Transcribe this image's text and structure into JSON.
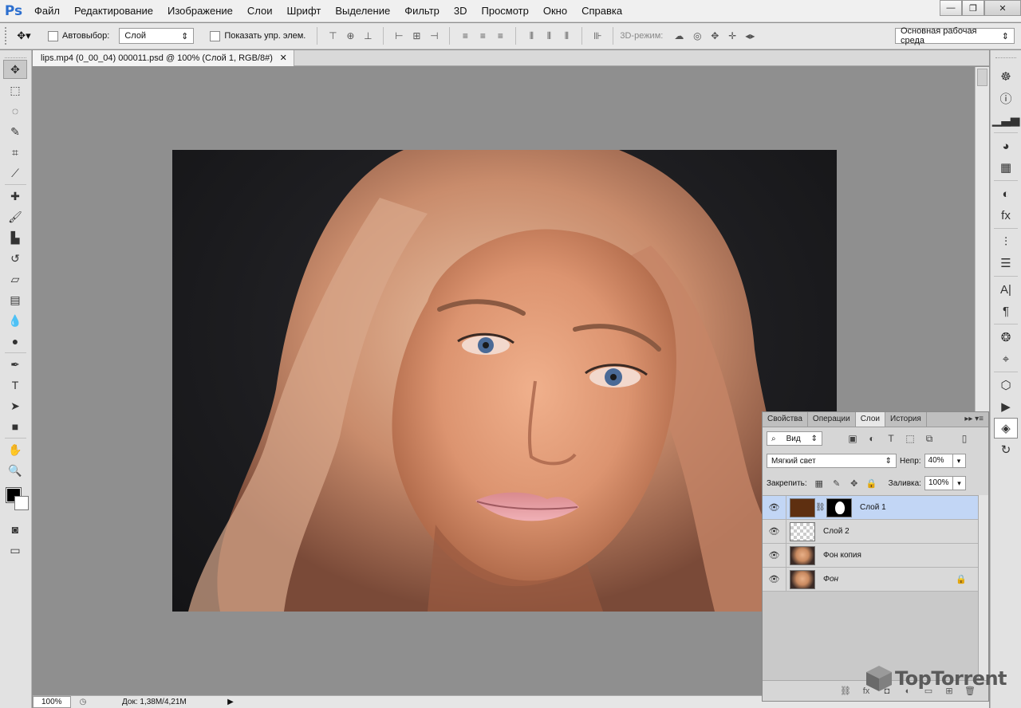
{
  "app": {
    "logo": "Ps"
  },
  "menu": [
    "Файл",
    "Редактирование",
    "Изображение",
    "Слои",
    "Шрифт",
    "Выделение",
    "Фильтр",
    "3D",
    "Просмотр",
    "Окно",
    "Справка"
  ],
  "window_controls": {
    "minimize": "—",
    "restore": "❐",
    "close": "✕"
  },
  "options": {
    "auto_select_label": "Автовыбор:",
    "auto_select_value": "Слой",
    "show_controls_label": "Показать упр. элем.",
    "mode_3d_label": "3D-режим:",
    "workspace_value": "Основная рабочая среда"
  },
  "document": {
    "tab_title": "lips.mp4 (0_00_04) 000011.psd @ 100% (Слой 1, RGB/8#)",
    "tab_close": "✕"
  },
  "status": {
    "zoom": "100%",
    "doc_info": "Док: 1,38М/4,21М",
    "arrow": "▶"
  },
  "layers_panel": {
    "tabs": [
      "Свойства",
      "Операции",
      "Слои",
      "История"
    ],
    "active_tab": "Слои",
    "tab_controls": "▸▸  ▾≡",
    "filter_value": "Вид",
    "blend_mode": "Мягкий свет",
    "opacity_label": "Непр:",
    "opacity_value": "40%",
    "lock_label": "Закрепить:",
    "fill_label": "Заливка:",
    "fill_value": "100%",
    "layers": [
      {
        "name": "Слой 1",
        "selected": true,
        "thumb": "brown",
        "mask": true,
        "italic": false,
        "locked": false
      },
      {
        "name": "Слой 2",
        "selected": false,
        "thumb": "trans",
        "mask": false,
        "italic": false,
        "locked": false
      },
      {
        "name": "Фон копия",
        "selected": false,
        "thumb": "photo",
        "mask": false,
        "italic": false,
        "locked": false
      },
      {
        "name": "Фон",
        "selected": false,
        "thumb": "photo",
        "mask": false,
        "italic": true,
        "locked": true
      }
    ]
  },
  "watermark": {
    "text": "TopTorrent"
  },
  "colors": {
    "foreground": "#000000",
    "background": "#ffffff",
    "selected_layer": "#c2d6f5",
    "layer1_fill": "#5e2f10"
  }
}
